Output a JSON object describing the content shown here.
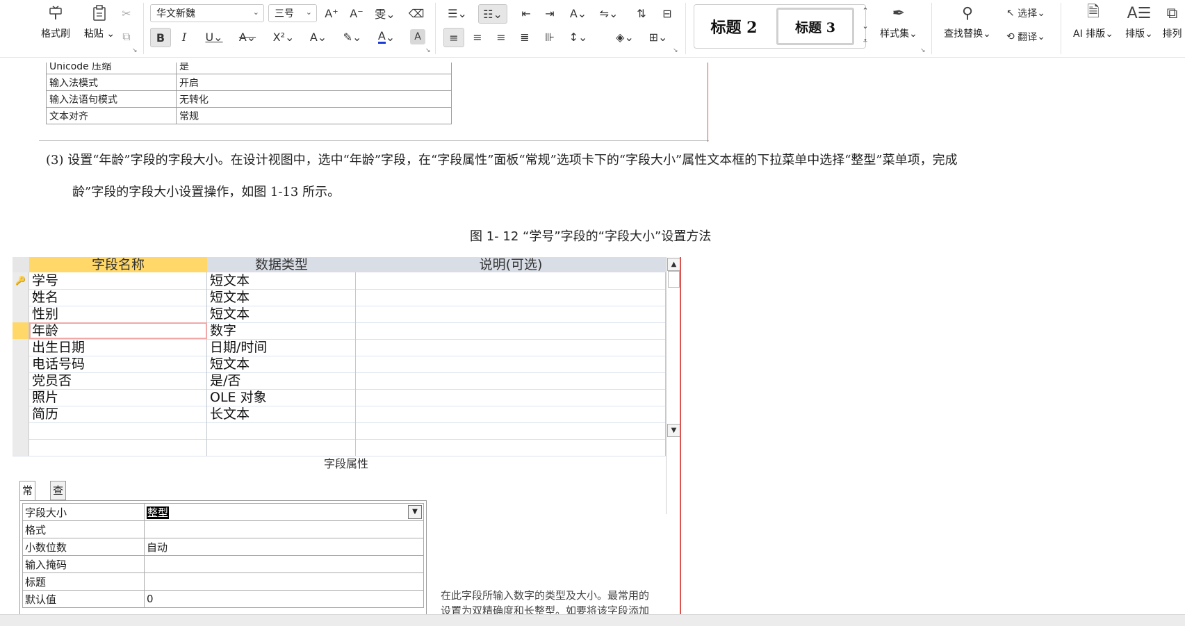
{
  "ribbon": {
    "clipboard": {
      "format_painter": "格式刷",
      "paste": "粘贴"
    },
    "font": {
      "name": "华文新魏",
      "size": "三号"
    },
    "styles": {
      "heading2": "标题 2",
      "heading3": "标题 3",
      "style_set": "样式集"
    },
    "editing": {
      "find_replace": "查找替换",
      "select": "选择",
      "translate": "翻译"
    },
    "ai": {
      "ai_layout": "AI 排版",
      "layout": "排版",
      "arrange": "排列"
    }
  },
  "doc": {
    "top_table": [
      {
        "name": "Unicode 压缩",
        "value": "是"
      },
      {
        "name": "输入法模式",
        "value": "开启"
      },
      {
        "name": "输入法语句模式",
        "value": "无转化"
      },
      {
        "name": "文本对齐",
        "value": "常规"
      }
    ],
    "para_line1": "(3) 设置“年龄”字段的字段大小。在设计视图中，选中“年龄”字段，在“字段属性”面板“常规”选项卡下的“字段大小”属性文本框的下拉菜单中选择“整型”菜单项，完成",
    "para_line2": "龄”字段的字段大小设置操作，如图 1-13 所示。",
    "caption": "图 1- 12 “学号”字段的“字段大小”设置方法"
  },
  "access": {
    "headers": {
      "field_name": "字段名称",
      "data_type": "数据类型",
      "description": "说明(可选)"
    },
    "rows": [
      {
        "name": "学号",
        "type": "短文本"
      },
      {
        "name": "姓名",
        "type": "短文本"
      },
      {
        "name": "性别",
        "type": "短文本"
      },
      {
        "name": "年龄",
        "type": "数字"
      },
      {
        "name": "出生日期",
        "type": "日期/时间"
      },
      {
        "name": "电话号码",
        "type": "短文本"
      },
      {
        "name": "党员否",
        "type": "是/否"
      },
      {
        "name": "照片",
        "type": "OLE 对象"
      },
      {
        "name": "简历",
        "type": "长文本"
      }
    ],
    "field_props_title": "字段属性",
    "tabs": {
      "general": "常规",
      "lookup": "查阅"
    },
    "props": [
      {
        "name": "字段大小",
        "value": "整型"
      },
      {
        "name": "格式",
        "value": ""
      },
      {
        "name": "小数位数",
        "value": "自动"
      },
      {
        "name": "输入掩码",
        "value": ""
      },
      {
        "name": "标题",
        "value": ""
      },
      {
        "name": "默认值",
        "value": "0"
      }
    ],
    "help_line1": "在此字段所输入数字的类型及大小。最常用的",
    "help_line2": "设置为双精确度和长整型。如要将该字段添加"
  },
  "colors": {
    "active_header": "#ffd869",
    "header": "#d9dee6",
    "margin_red": "#d9534f"
  }
}
